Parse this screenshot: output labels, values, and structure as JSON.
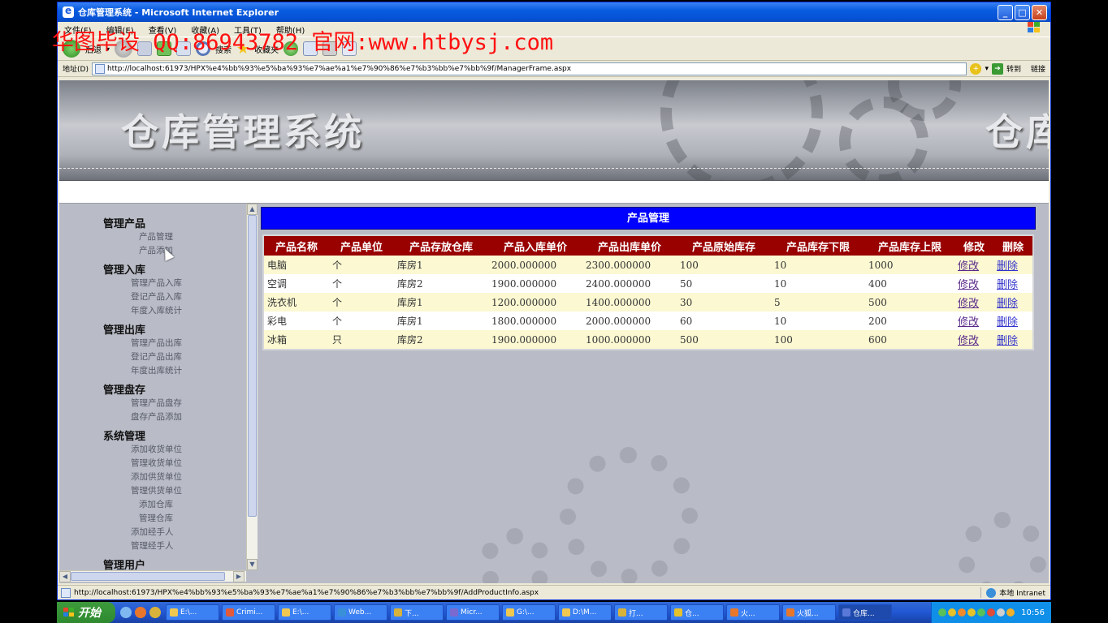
{
  "window": {
    "title": "仓库管理系统 - Microsoft Internet Explorer",
    "buttons": {
      "minimize": "_",
      "maximize": "□",
      "close": "✕"
    }
  },
  "menu": [
    "文件(F)",
    "编辑(E)",
    "查看(V)",
    "收藏(A)",
    "工具(T)",
    "帮助(H)"
  ],
  "toolbar": {
    "back_label": "后退",
    "search_label": "搜索",
    "favorites_label": "收藏夹"
  },
  "address": {
    "label": "地址(D)",
    "url": "http://localhost:61973/HPX%e4%bb%93%e5%ba%93%e7%ae%a1%e7%90%86%e7%b3%bb%e7%bb%9f/ManagerFrame.aspx",
    "go_label": "转到",
    "links_label": "链接"
  },
  "watermark": "华图毕设 QQ:86943782 官网:www.htbysj.com",
  "banner": {
    "title": "仓库管理系统",
    "title_repeat": "仓库"
  },
  "nav": [
    {
      "title": "管理产品",
      "items": [
        "产品管理",
        "产品添加"
      ]
    },
    {
      "title": "管理入库",
      "items": [
        "管理产品入库",
        "登记产品入库",
        "年度入库统计"
      ]
    },
    {
      "title": "管理出库",
      "items": [
        "管理产品出库",
        "登记产品出库",
        "年度出库统计"
      ]
    },
    {
      "title": "管理盘存",
      "items": [
        "管理产品盘存",
        "盘存产品添加"
      ]
    },
    {
      "title": "系统管理",
      "items": [
        "添加收货单位",
        "管理收货单位",
        "添加供货单位",
        "管理供货单位",
        "添加仓库",
        "管理仓库",
        "添加经手人",
        "管理经手人"
      ]
    },
    {
      "title": "管理用户",
      "items": []
    }
  ],
  "main": {
    "title": "产品管理",
    "columns": [
      "产品名称",
      "产品单位",
      "产品存放仓库",
      "产品入库单价",
      "产品出库单价",
      "产品原始库存",
      "产品库存下限",
      "产品库存上限",
      "修改",
      "删除"
    ],
    "rows": [
      {
        "name": "电脑",
        "unit": "个",
        "warehouse": "库房1",
        "in_price": "2000.000000",
        "out_price": "2300.000000",
        "initial": "100",
        "lower": "10",
        "upper": "1000",
        "edit": "修改",
        "delete": "删除"
      },
      {
        "name": "空调",
        "unit": "个",
        "warehouse": "库房2",
        "in_price": "1900.000000",
        "out_price": "2400.000000",
        "initial": "50",
        "lower": "10",
        "upper": "400",
        "edit": "修改",
        "delete": "删除"
      },
      {
        "name": "洗衣机",
        "unit": "个",
        "warehouse": "库房1",
        "in_price": "1200.000000",
        "out_price": "1400.000000",
        "initial": "30",
        "lower": "5",
        "upper": "500",
        "edit": "修改",
        "delete": "删除"
      },
      {
        "name": "彩电",
        "unit": "个",
        "warehouse": "库房1",
        "in_price": "1800.000000",
        "out_price": "2000.000000",
        "initial": "60",
        "lower": "10",
        "upper": "200",
        "edit": "修改",
        "delete": "删除"
      },
      {
        "name": "冰箱",
        "unit": "只",
        "warehouse": "库房2",
        "in_price": "1900.000000",
        "out_price": "1000.000000",
        "initial": "500",
        "lower": "100",
        "upper": "600",
        "edit": "修改",
        "delete": "删除"
      }
    ]
  },
  "status": {
    "url": "http://localhost:61973/HPX%e4%bb%93%e5%ba%93%e7%ae%a1%e7%90%86%e7%b3%bb%e7%bb%9f/AddProductInfo.aspx",
    "zone": "本地 Intranet"
  },
  "taskbar": {
    "start_label": "开始",
    "tasks": [
      "E:\\...",
      "Crimi...",
      "E:\\...",
      "Web...",
      "下...",
      "Micr...",
      "G:\\...",
      "D:\\M...",
      "打...",
      "仓...",
      "火...",
      "火狐...",
      "仓库..."
    ],
    "clock": "10:56"
  },
  "colors": {
    "header_row": "#990000",
    "title_bar": "#0000ff",
    "odd_row": "#fbf8d2",
    "link": "#3333cc"
  }
}
